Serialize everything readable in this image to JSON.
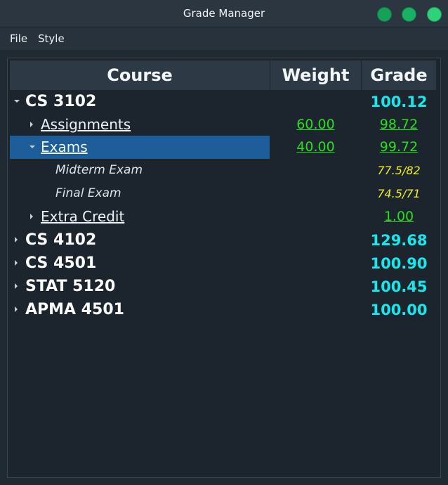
{
  "window": {
    "title": "Grade Manager",
    "colors": {
      "accent": "#1d5d9a",
      "grade_course": "#13e9ef",
      "grade_category": "#22e01c",
      "grade_item": "#f2f21a"
    }
  },
  "menu": {
    "file": "File",
    "style": "Style"
  },
  "columns": {
    "course": "Course",
    "weight": "Weight",
    "grade": "Grade"
  },
  "rows": [
    {
      "label": "CS 3102",
      "weight": "",
      "grade": "100.12",
      "kind": "course",
      "expanded": true
    },
    {
      "label": "Assignments",
      "weight": "60.00",
      "grade": "98.72",
      "kind": "category",
      "expanded": false
    },
    {
      "label": "Exams",
      "weight": "40.00",
      "grade": "99.72",
      "kind": "category",
      "expanded": true,
      "selected": true
    },
    {
      "label": "Midterm Exam",
      "weight": "",
      "grade": "77.5/82",
      "kind": "item"
    },
    {
      "label": "Final Exam",
      "weight": "",
      "grade": "74.5/71",
      "kind": "item"
    },
    {
      "label": "Extra Credit",
      "weight": "",
      "grade": "1.00",
      "kind": "category",
      "expanded": false
    },
    {
      "label": "CS 4102",
      "weight": "",
      "grade": "129.68",
      "kind": "course",
      "expanded": false
    },
    {
      "label": "CS 4501",
      "weight": "",
      "grade": "100.90",
      "kind": "course",
      "expanded": false
    },
    {
      "label": "STAT 5120",
      "weight": "",
      "grade": "100.45",
      "kind": "course",
      "expanded": false
    },
    {
      "label": "APMA 4501",
      "weight": "",
      "grade": "100.00",
      "kind": "course",
      "expanded": false
    }
  ]
}
